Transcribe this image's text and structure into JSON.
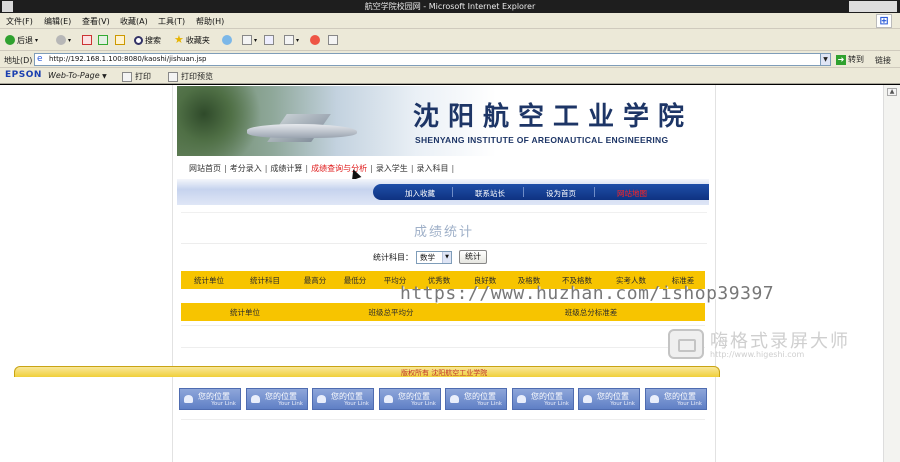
{
  "window": {
    "title": "航空学院校园网 - Microsoft Internet Explorer"
  },
  "menu": [
    "文件(F)",
    "编辑(E)",
    "查看(V)",
    "收藏(A)",
    "工具(T)",
    "帮助(H)"
  ],
  "toolbar": {
    "back": "后退",
    "search": "搜索",
    "favorites": "收藏夹"
  },
  "address": {
    "label": "地址(D)",
    "url": "http://192.168.1.100:8080/kaoshi/jishuan.jsp",
    "go": "转到",
    "links": "链接"
  },
  "epson": {
    "brand": "EPSON",
    "web_to_page": "Web-To-Page",
    "print": "打印",
    "print_preview": "打印预览"
  },
  "banner": {
    "title_cn": "沈阳航空工业学院",
    "title_en": "SHENYANG INSTITUTE OF AREONAUTICAL ENGINEERING"
  },
  "nav": [
    {
      "label": "网站首页"
    },
    {
      "label": "考分录入"
    },
    {
      "label": "成绩计算"
    },
    {
      "label": "成绩查询与分析"
    },
    {
      "label": "录入学生"
    },
    {
      "label": "录入科目"
    }
  ],
  "bluebar": {
    "items": [
      "加入收藏",
      "联系站长",
      "设为首页"
    ],
    "highlight": "网站地图"
  },
  "stats": {
    "title": "成绩统计",
    "subject_label": "统计科目：",
    "subject_value": "数学",
    "button": "统计",
    "headers": [
      "统计单位",
      "统计科目",
      "最高分",
      "最低分",
      "平均分",
      "优秀数",
      "良好数",
      "及格数",
      "不及格数",
      "实考人数",
      "标准差"
    ],
    "headers2": [
      "统计单位",
      "班级总平均分",
      "班级总分标准差"
    ]
  },
  "linkButtons": [
    {
      "text": "您的位置",
      "sub": "Your Link"
    },
    {
      "text": "您的位置",
      "sub": "Your Link"
    },
    {
      "text": "您的位置",
      "sub": "Your Link"
    },
    {
      "text": "您的位置",
      "sub": "Your Link"
    },
    {
      "text": "您的位置",
      "sub": "Your Link"
    },
    {
      "text": "您的位置",
      "sub": "Your Link"
    },
    {
      "text": "您的位置",
      "sub": "Your Link"
    },
    {
      "text": "您的位置",
      "sub": "Your Link"
    }
  ],
  "footer": {
    "text": "版权所有 沈阳航空工业学院"
  },
  "watermark": {
    "url": "https://www.huzhan.com/ishop39397",
    "recorder": "嗨格式录屏大师",
    "recorder_url": "http://www.higeshi.com"
  }
}
